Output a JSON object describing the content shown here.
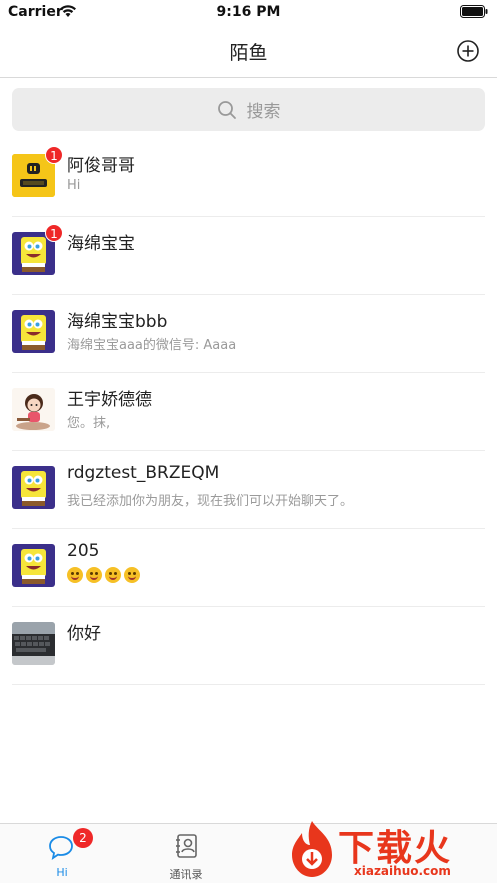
{
  "status_bar": {
    "carrier": "Carrier",
    "time": "9:16 PM"
  },
  "nav": {
    "title": "陌鱼"
  },
  "search": {
    "placeholder": "搜索"
  },
  "chats": [
    {
      "name": "阿俊哥哥",
      "preview": "Hi",
      "badge": "1",
      "avatar": "hi-app-icon"
    },
    {
      "name": "海绵宝宝",
      "preview": "",
      "badge": "1",
      "avatar": "spongebob"
    },
    {
      "name": "海绵宝宝bbb",
      "preview": "海绵宝宝aaa的微信号: Aaaa",
      "badge": "",
      "avatar": "spongebob"
    },
    {
      "name": "王宇娇德德",
      "preview": "您。抹,",
      "badge": "",
      "avatar": "cartoon-girl"
    },
    {
      "name": "rdgztest_BRZEQM",
      "preview": "我已经添加你为朋友，现在我们可以开始聊天了。",
      "badge": "",
      "avatar": "spongebob"
    },
    {
      "name": "205",
      "preview": "😘😘😅😅",
      "badge": "",
      "avatar": "spongebob"
    },
    {
      "name": "你好",
      "preview": "",
      "badge": "",
      "avatar": "keyboard-photo"
    }
  ],
  "tabs": [
    {
      "label": "Hi",
      "badge": "2",
      "icon": "chat-bubble-icon",
      "active": true
    },
    {
      "label": "通讯录",
      "badge": "",
      "icon": "contacts-icon",
      "active": false
    }
  ],
  "watermark": {
    "text": "下载火",
    "sub": "xiazaihuo.com"
  },
  "colors": {
    "accent": "#1a8be6",
    "badge": "#ef2828",
    "watermark": "#e8361c"
  }
}
